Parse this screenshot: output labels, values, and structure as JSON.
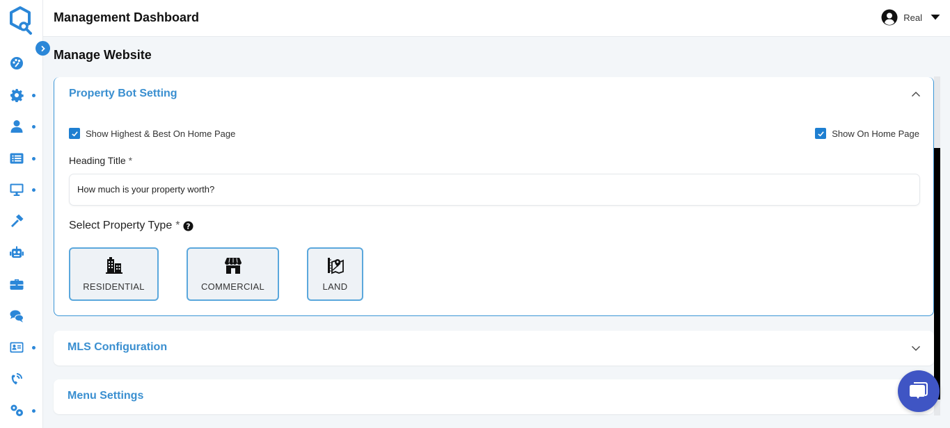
{
  "app": {
    "title": "Management Dashboard",
    "brand_color": "#2b87d8",
    "logo_icon": "search-home-logo"
  },
  "user": {
    "name": "Real",
    "icon": "user-circle-icon"
  },
  "sidebar": {
    "collapse_icon": "chevron-right-icon",
    "items": [
      {
        "icon": "palette-icon",
        "has_submenu": false
      },
      {
        "icon": "gear-icon",
        "has_submenu": true
      },
      {
        "icon": "user-icon",
        "has_submenu": true
      },
      {
        "icon": "list-icon",
        "has_submenu": true
      },
      {
        "icon": "monitor-icon",
        "has_submenu": true
      },
      {
        "icon": "hammer-icon",
        "has_submenu": false
      },
      {
        "icon": "robot-icon",
        "has_submenu": false
      },
      {
        "icon": "briefcase-icon",
        "has_submenu": false
      },
      {
        "icon": "chat-icon",
        "has_submenu": false
      },
      {
        "icon": "id-card-icon",
        "has_submenu": true
      },
      {
        "icon": "phone-signal-icon",
        "has_submenu": false
      },
      {
        "icon": "gears-icon",
        "has_submenu": true
      }
    ]
  },
  "page": {
    "title": "Manage Website"
  },
  "panels": {
    "property_bot": {
      "title": "Property Bot Setting",
      "expanded": true,
      "show_highest_best": {
        "label": "Show Highest & Best On Home Page",
        "checked": true
      },
      "show_on_home": {
        "label": "Show On Home Page",
        "checked": true
      },
      "heading_title": {
        "label": "Heading Title",
        "required_mark": "*",
        "value": "How much is your property worth?"
      },
      "property_type": {
        "label": "Select Property Type",
        "required_mark": "*",
        "help_icon": "question-circle-icon",
        "options": [
          {
            "label": "RESIDENTIAL",
            "icon": "building-icon"
          },
          {
            "label": "COMMERCIAL",
            "icon": "store-icon"
          },
          {
            "label": "LAND",
            "icon": "map-location-icon"
          }
        ]
      }
    },
    "mls": {
      "title": "MLS Configuration",
      "expanded": false
    },
    "menu": {
      "title": "Menu Settings",
      "expanded": false
    }
  },
  "chat_widget": {
    "icon": "chat-bubble-icon"
  }
}
